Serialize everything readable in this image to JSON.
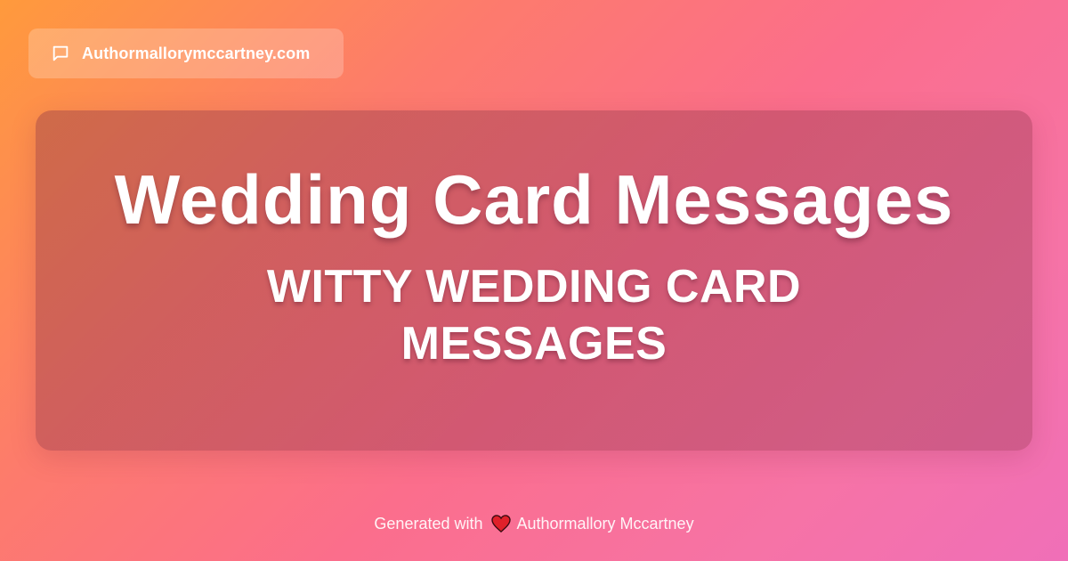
{
  "header": {
    "site_name": "Authormallorymccartney.com",
    "icon": "chat-bubble-icon"
  },
  "card": {
    "title": "Wedding Card Messages",
    "subtitle": "WITTY WEDDING CARD MESSAGES"
  },
  "footer": {
    "prefix": "Generated with",
    "icon": "heart-icon",
    "author": "Authormallory Mccartney"
  },
  "colors": {
    "gradient_start": "#ff9a3c",
    "gradient_mid": "#fb6e8c",
    "gradient_end": "#f06fb8",
    "heart": "#e0202a",
    "text": "#ffffff"
  }
}
